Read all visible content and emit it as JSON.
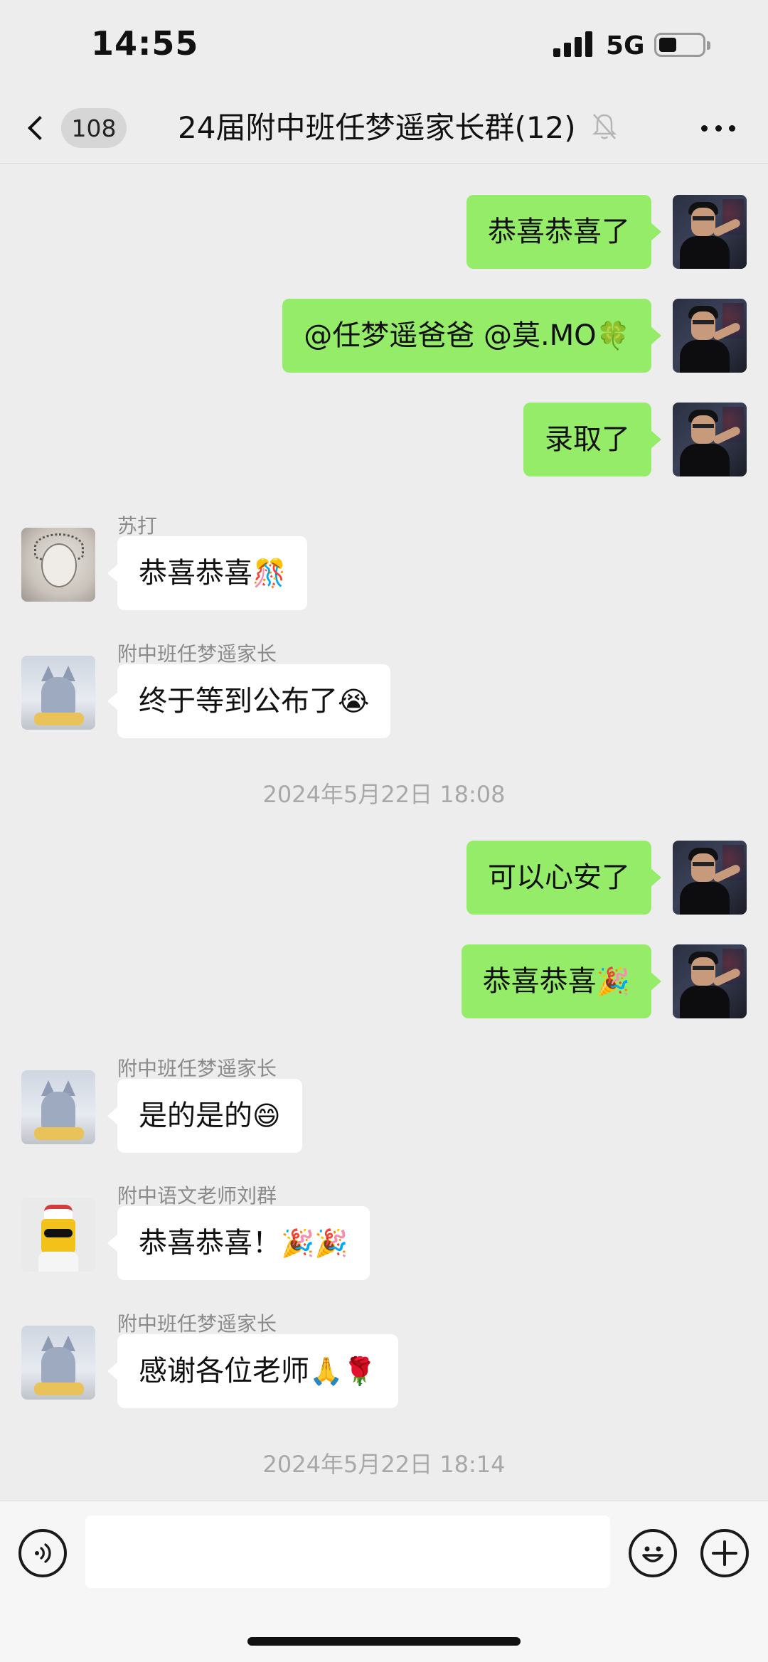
{
  "status_bar": {
    "time": "14:55",
    "network": "5G",
    "battery_level": 0.4
  },
  "nav": {
    "unread_count": "108",
    "title": "24届附中班任梦遥家长群(12)",
    "muted": true,
    "back_icon": "chevron-left-icon",
    "more_icon": "more-dots-icon"
  },
  "messages": [
    {
      "direction": "out",
      "text": "恭喜恭喜了"
    },
    {
      "direction": "out",
      "text": "@任梦遥爸爸 @莫.MO",
      "emoji": "🍀"
    },
    {
      "direction": "out",
      "text": "录取了"
    },
    {
      "direction": "in",
      "sender": "苏打",
      "text": "恭喜恭喜",
      "emoji": "🎊"
    },
    {
      "direction": "in",
      "sender": "附中班任梦遥家长",
      "text": "终于等到公布了",
      "emoji": "😭"
    },
    {
      "direction": "out",
      "text": "可以心安了"
    },
    {
      "direction": "out",
      "text": "恭喜恭喜",
      "emoji": "🎉"
    },
    {
      "direction": "in",
      "sender": "附中班任梦遥家长",
      "text": "是的是的",
      "emoji": "😄"
    },
    {
      "direction": "in",
      "sender": "附中语文老师刘群",
      "text": "恭喜恭喜！",
      "emoji": "🎉🎉"
    },
    {
      "direction": "in",
      "sender": "附中班任梦遥家长",
      "text": "感谢各位老师",
      "emoji": "🙏🌹"
    }
  ],
  "timestamps": [
    "2024年5月22日 18:08",
    "2024年5月22日 18:14"
  ],
  "input": {
    "value": "",
    "voice_icon": "voice-icon",
    "emoji_icon": "emoji-icon",
    "plus_icon": "plus-icon"
  },
  "colors": {
    "outgoing_bubble": "#95ec69",
    "incoming_bubble": "#ffffff",
    "background": "#ededed"
  }
}
